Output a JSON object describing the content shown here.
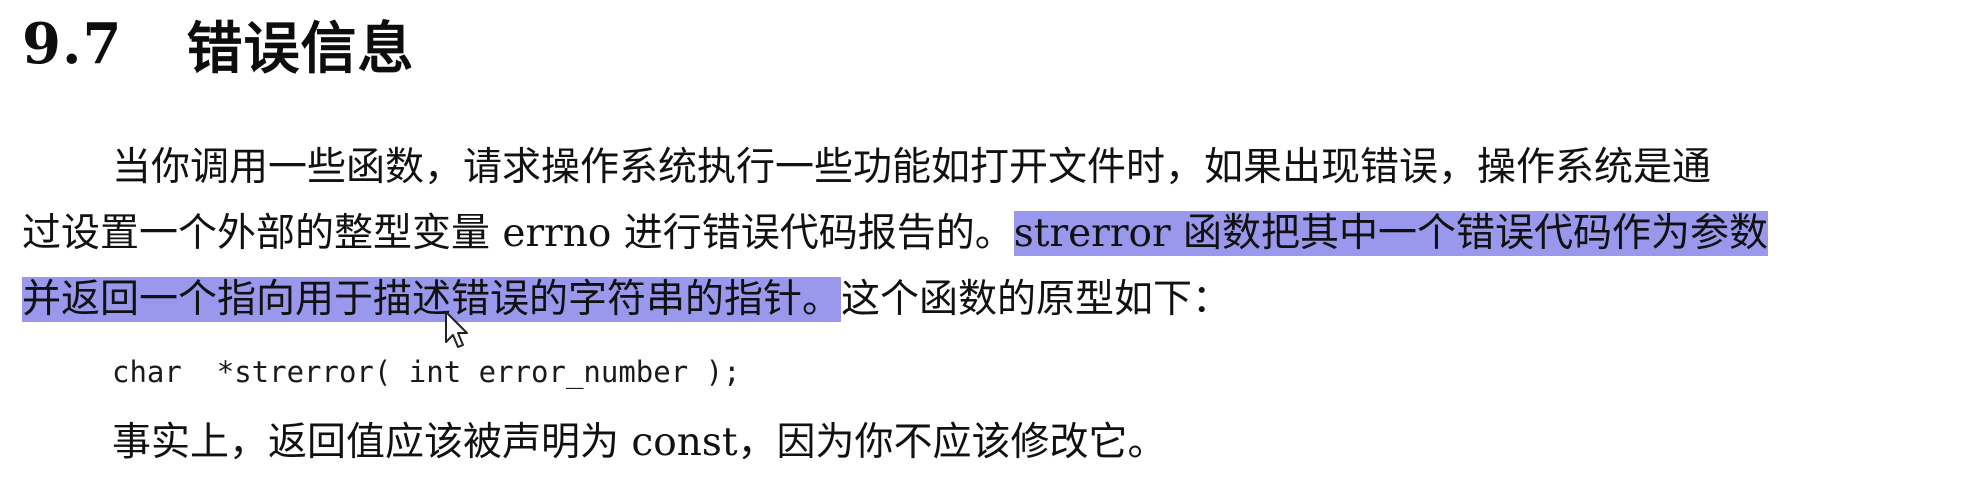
{
  "heading": {
    "number": "9.7",
    "title": "错误信息"
  },
  "paragraph1": {
    "line1": "当你调用一些函数，请求操作系统执行一些功能如打开文件时，如果出现错误，操作系统是通",
    "line2_plain": "过设置一个外部的整型变量 errno 进行错误代码报告的。",
    "line2_highlight": "strerror 函数把其中一个错误代码作为参数",
    "line3_highlight": "并返回一个指向用于描述错误的字符串的指针。",
    "line3_plain": "这个函数的原型如下："
  },
  "code": {
    "prototype": "char  *strerror( int error_number );"
  },
  "paragraph2": {
    "text": "事实上，返回值应该被声明为 const，因为你不应该修改它。"
  },
  "colors": {
    "selection_highlight": "#9a98ec",
    "text": "#111111"
  },
  "icons": {
    "cursor": "mouse-pointer-icon"
  }
}
